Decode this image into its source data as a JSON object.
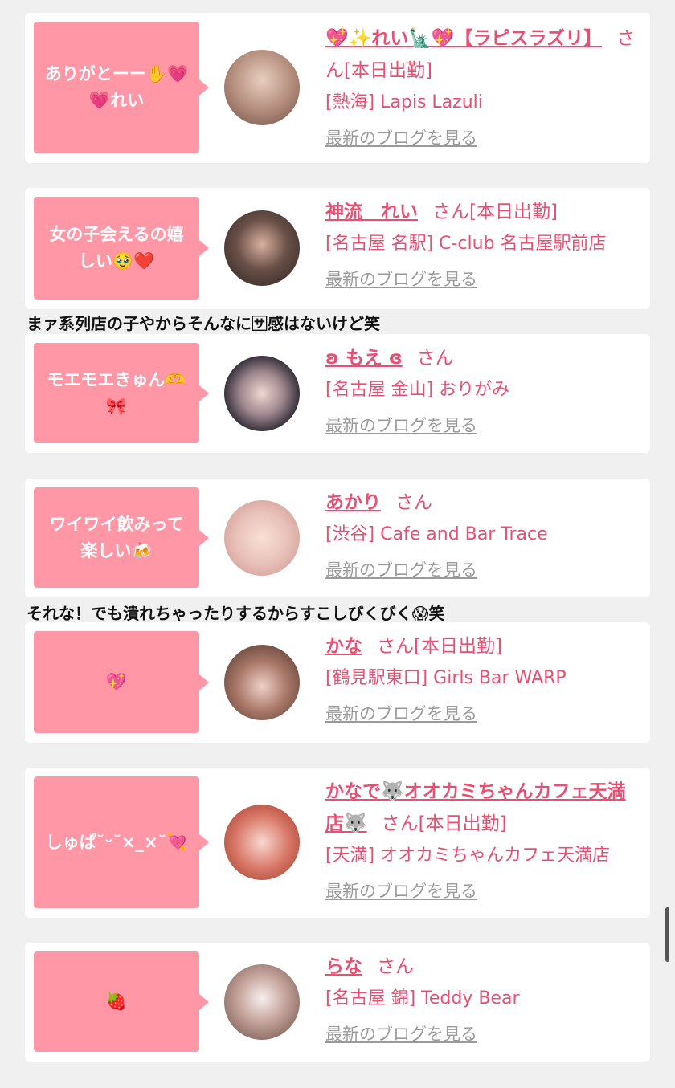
{
  "cards": [
    {
      "message": "ありがとーー✋💗💗れい",
      "name": "💖✨れい🗽💖【ラピスラズリ】",
      "honorific": "さん",
      "shift": "[本日出勤]",
      "shop": "[熱海] Lapis Lazuli",
      "blog_link": "最新のブログを見る",
      "avatar_color": "#b08878"
    },
    {
      "message": "女の子会えるの嬉しい🥹❤️",
      "name": "神流　れい",
      "honorific": "さん",
      "shift": "[本日出勤]",
      "shop": "[名古屋 名駅] C-club 名古屋駅前店",
      "blog_link": "最新のブログを見る",
      "avatar_color": "#4a3c38"
    },
    {
      "message": "モエモエきゅん🫶🎀",
      "name": "ʚ もえ ɞ",
      "honorific": "さん",
      "shift": "",
      "shop": "[名古屋 金山] おりがみ",
      "blog_link": "最新のブログを見る",
      "avatar_color": "#2a2630"
    },
    {
      "message": "ワイワイ飲みって楽しい🍻",
      "name": "あかり",
      "honorific": "さん",
      "shift": "",
      "shop": "[渋谷] Cafe and Bar Trace",
      "blog_link": "最新のブログを見る",
      "avatar_color": "#e8c0b8"
    },
    {
      "message": "💖",
      "name": "かな",
      "honorific": "さん",
      "shift": "[本日出勤]",
      "shop": "[鶴見駅東口] Girls Bar WARP",
      "blog_link": "最新のブログを見る",
      "avatar_color": "#6a4a40"
    },
    {
      "message": "しゅぱ˘ᵕ˘×_×˘💘",
      "name": "かなで🐺オオカミちゃんカフェ天満店🐺",
      "honorific": "さん",
      "shift": "[本日出勤]",
      "shop": "[天満] オオカミちゃんカフェ天満店",
      "blog_link": "最新のブログを見る",
      "avatar_color": "#c86050"
    },
    {
      "message": "🍓",
      "name": "らな",
      "honorific": "さん",
      "shift": "",
      "shop": "[名古屋 錦] Teddy Bear",
      "blog_link": "最新のブログを見る",
      "avatar_color": "#a08070"
    }
  ],
  "captions": {
    "after_card_2": "まァ系列店の子やからそんなに🈂感はないけど笑",
    "after_card_4": "それな！でも潰れちゃったりするからすこしびくびく😱笑"
  }
}
